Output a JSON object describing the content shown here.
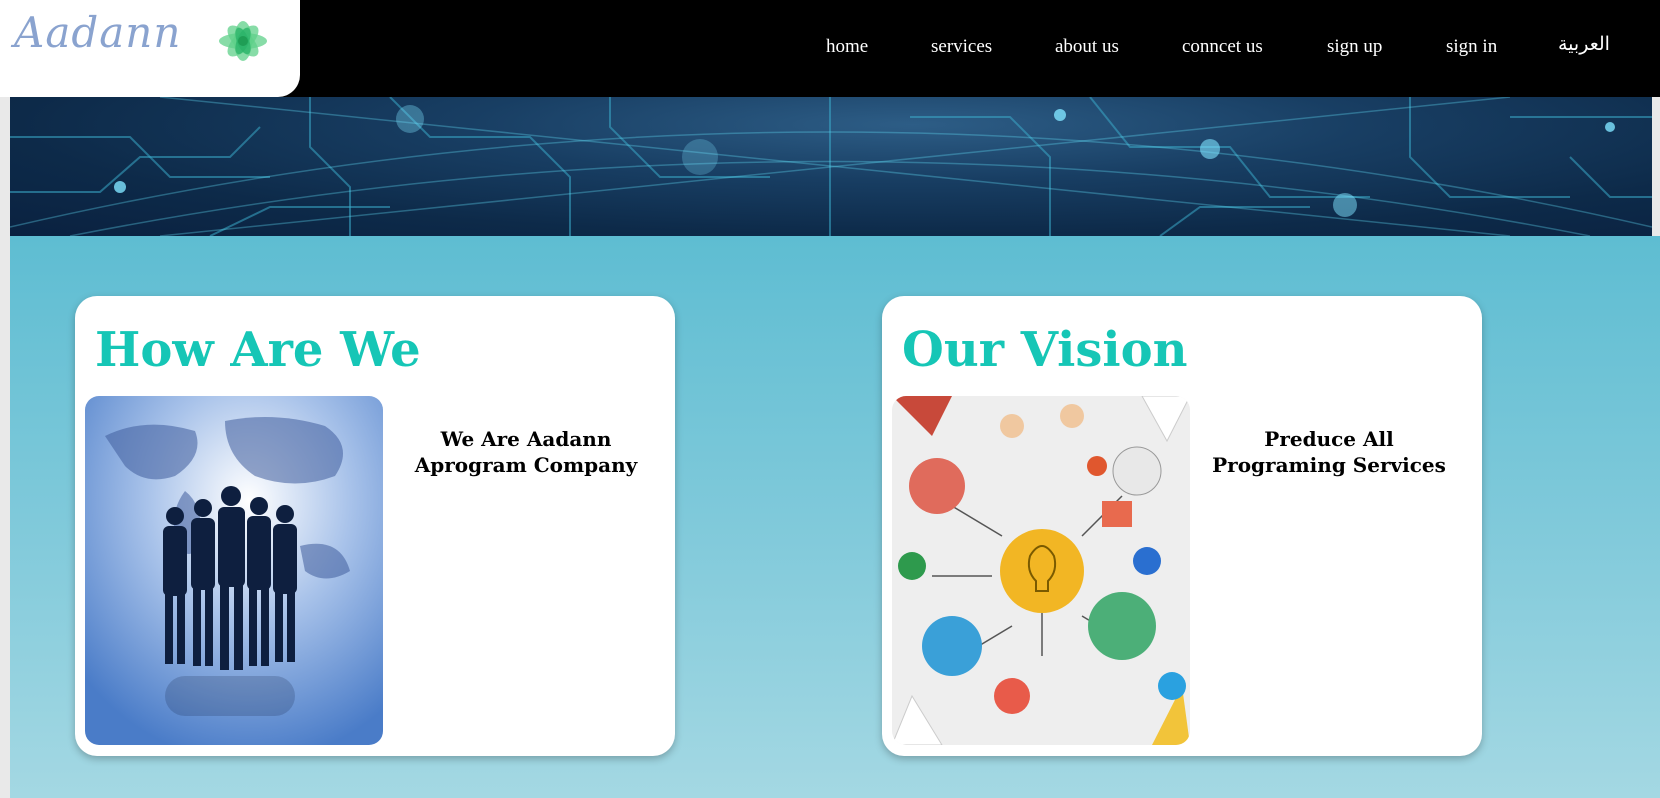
{
  "brand": {
    "logo_text": "Aadann",
    "logo_icon": "lotus-flower-icon",
    "accent_color": "#16c6b6"
  },
  "nav": {
    "home": "home",
    "services": "services",
    "about": "about us",
    "contact": "conncet us",
    "signup": "sign up",
    "signin": "sign in",
    "arabic": "العربية"
  },
  "cards": [
    {
      "title": "How Are We",
      "text": "We Are Aadann Aprogram Company",
      "image": "business-team-silhouette-world-map"
    },
    {
      "title": "Our Vision",
      "text": "Preduce All Programing Services",
      "image": "team-brainstorm-lightbulb-illustration"
    }
  ]
}
